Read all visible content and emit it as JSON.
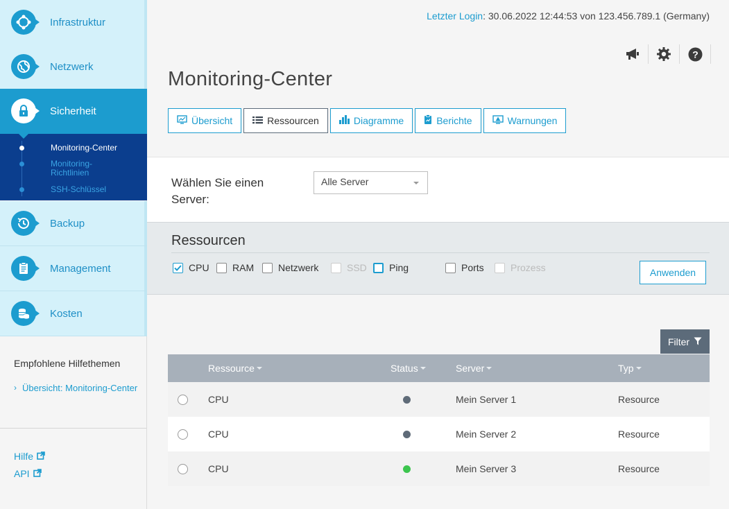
{
  "sidebar": {
    "nav": [
      {
        "label": "Infrastruktur",
        "icon": "infrastructure-icon"
      },
      {
        "label": "Netzwerk",
        "icon": "globe-icon"
      },
      {
        "label": "Sicherheit",
        "icon": "lock-icon",
        "active": true
      },
      {
        "label": "Backup",
        "icon": "clock-history-icon"
      },
      {
        "label": "Management",
        "icon": "clipboard-icon"
      },
      {
        "label": "Kosten",
        "icon": "coins-icon"
      }
    ],
    "subnav": [
      {
        "label": "Monitoring-Center",
        "active": true
      },
      {
        "label": "Monitoring-Richtlinien"
      },
      {
        "label": "SSH-Schlüssel"
      }
    ],
    "help_title": "Empfohlene Hilfethemen",
    "help_link": "Übersicht: Monitoring-Center",
    "links": {
      "help": "Hilfe",
      "api": "API"
    }
  },
  "header": {
    "last_login_label": "Letzter Login",
    "last_login_value": ": 30.06.2022 12:44:53 von 123.456.789.1 (Germany)",
    "icons": [
      "megaphone-icon",
      "gear-icon",
      "help-icon"
    ]
  },
  "page_title": "Monitoring-Center",
  "tabs": [
    {
      "label": "Übersicht",
      "icon": "monitor-icon"
    },
    {
      "label": "Ressourcen",
      "icon": "list-icon",
      "active": true
    },
    {
      "label": "Diagramme",
      "icon": "bar-chart-icon"
    },
    {
      "label": "Berichte",
      "icon": "report-icon"
    },
    {
      "label": "Warnungen",
      "icon": "warning-monitor-icon"
    }
  ],
  "server_select": {
    "label": "Wählen Sie einen Server:",
    "value": "Alle Server"
  },
  "resources": {
    "title": "Ressourcen",
    "checkboxes": [
      {
        "label": "CPU",
        "checked": true
      },
      {
        "label": "RAM",
        "checked": false
      },
      {
        "label": "Netzwerk",
        "checked": false
      },
      {
        "label": "SSD",
        "checked": false,
        "disabled": true
      },
      {
        "label": "Ping",
        "checked": false,
        "focused": true
      },
      {
        "label": "Ports",
        "checked": false
      },
      {
        "label": "Prozess",
        "checked": false,
        "disabled": true
      }
    ],
    "apply_label": "Anwenden"
  },
  "filter_label": "Filter",
  "table": {
    "columns": [
      "Ressource",
      "Status",
      "Server",
      "Typ"
    ],
    "rows": [
      {
        "resource": "CPU",
        "status_color": "#5f6b78",
        "server": "Mein Server 1",
        "type": "Resource"
      },
      {
        "resource": "CPU",
        "status_color": "#5f6b78",
        "server": "Mein Server 2",
        "type": "Resource"
      },
      {
        "resource": "CPU",
        "status_color": "#3cc54e",
        "server": "Mein Server 3",
        "type": "Resource"
      }
    ]
  },
  "colors": {
    "accent": "#1c9ccf",
    "active_nav": "#1c9ccf",
    "subnav_bg": "#0b3e8e"
  }
}
